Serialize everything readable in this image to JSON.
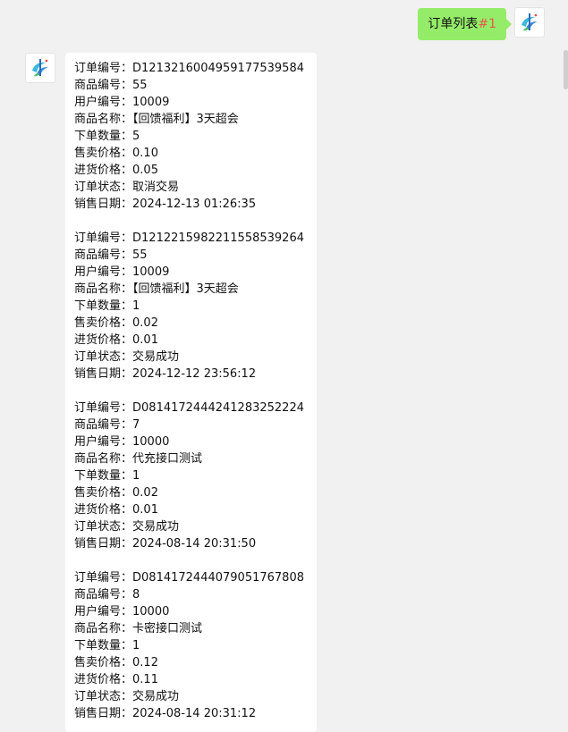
{
  "sent_message": {
    "text": "订单列表",
    "tag": "#1"
  },
  "field_labels": {
    "order_no": "订单编号：",
    "product_no": "商品编号：",
    "user_no": "用户编号：",
    "product_name": "商品名称：",
    "quantity": "下单数量：",
    "sale_price": "售卖价格：",
    "cost_price": "进货价格：",
    "status": "订单状态：",
    "sale_date": "销售日期："
  },
  "orders": [
    {
      "order_no": "D1213216004959177539584",
      "product_no": "55",
      "user_no": "10009",
      "product_name": "【回馈福利】3天超会",
      "quantity": "5",
      "sale_price": "0.10",
      "cost_price": "0.05",
      "status": "取消交易",
      "sale_date": "2024-12-13 01:26:35"
    },
    {
      "order_no": "D1212215982211558539264",
      "product_no": "55",
      "user_no": "10009",
      "product_name": "【回馈福利】3天超会",
      "quantity": "1",
      "sale_price": "0.02",
      "cost_price": "0.01",
      "status": "交易成功",
      "sale_date": "2024-12-12 23:56:12"
    },
    {
      "order_no": "D0814172444241283252224",
      "product_no": "7",
      "user_no": "10000",
      "product_name": "代充接口测试",
      "quantity": "1",
      "sale_price": "0.02",
      "cost_price": "0.01",
      "status": "交易成功",
      "sale_date": "2024-08-14 20:31:50"
    },
    {
      "order_no": "D0814172444079051767808",
      "product_no": "8",
      "user_no": "10000",
      "product_name": "卡密接口测试",
      "quantity": "1",
      "sale_price": "0.12",
      "cost_price": "0.11",
      "status": "交易成功",
      "sale_date": "2024-08-14 20:31:12"
    }
  ],
  "colors": {
    "background": "#f1f1f1",
    "sent_bubble": "#95ec69",
    "received_bubble": "#ffffff",
    "tag": "#e25b4e"
  },
  "icons": {
    "avatar": "bot-logo-icon"
  }
}
